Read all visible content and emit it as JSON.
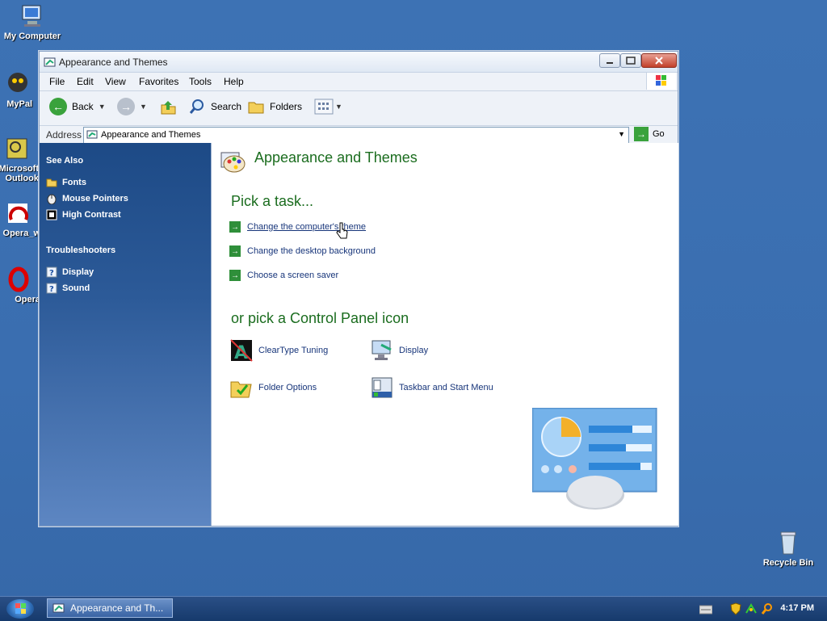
{
  "desktop": {
    "icons": [
      {
        "label": "My Computer"
      },
      {
        "label": "MyPal"
      },
      {
        "label": "Microsoft Outlook"
      },
      {
        "label": "Opera_w"
      },
      {
        "label": "Opera"
      },
      {
        "label": "Recycle Bin"
      }
    ]
  },
  "window": {
    "title": "Appearance and Themes",
    "menu": [
      "File",
      "Edit",
      "View",
      "Favorites",
      "Tools",
      "Help"
    ],
    "toolbar": {
      "back": "Back",
      "search": "Search",
      "folders": "Folders"
    },
    "address": {
      "label": "Address",
      "value": "Appearance and Themes",
      "go": "Go"
    }
  },
  "sidebar": {
    "see_also": {
      "heading": "See Also",
      "items": [
        "Fonts",
        "Mouse Pointers",
        "High Contrast"
      ]
    },
    "troubleshooters": {
      "heading": "Troubleshooters",
      "items": [
        "Display",
        "Sound"
      ]
    }
  },
  "main": {
    "title": "Appearance and Themes",
    "pick_task": "Pick a task...",
    "tasks": [
      "Change the computer's theme",
      "Change the desktop background",
      "Choose a screen saver"
    ],
    "pick_icon": "or pick a Control Panel icon",
    "icons": [
      "ClearType Tuning",
      "Display",
      "Folder Options",
      "Taskbar and Start Menu"
    ]
  },
  "taskbar": {
    "task_button": "Appearance and Th...",
    "clock": "4:17 PM"
  },
  "colors": {
    "accent_green": "#1b6d1f",
    "link_blue": "#17357a",
    "sidebar_blue": "#2c5a98"
  }
}
